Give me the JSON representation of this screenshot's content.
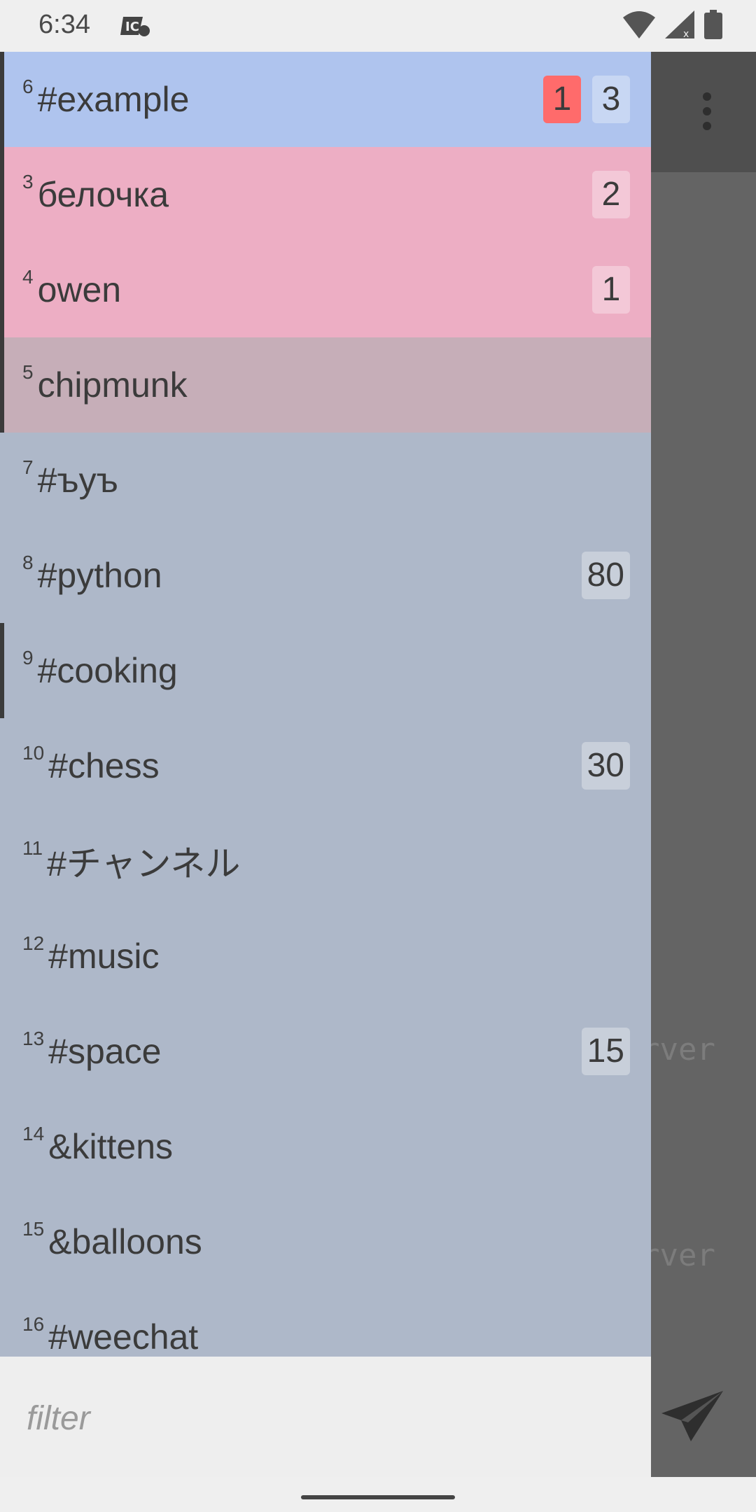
{
  "status_bar": {
    "time": "6:34",
    "icons": [
      "app-notification-icon",
      "wifi-icon",
      "cell-signal-icon",
      "battery-icon"
    ]
  },
  "background": {
    "text_1": "rver",
    "text_2": "rver"
  },
  "colors": {
    "active_row": "#afc4ee",
    "private_row": "#edaec4",
    "selected_private_row": "#c6aeb8",
    "drawer_bg": "#aeb8c9",
    "highlight_badge": "#ff6b6b"
  },
  "buffers": [
    {
      "num": "6",
      "name": "#example",
      "highlight": "1",
      "unread": "3"
    },
    {
      "num": "3",
      "name": "белочка",
      "unread": "2"
    },
    {
      "num": "4",
      "name": "owen",
      "unread": "1"
    },
    {
      "num": "5",
      "name": "chipmunk"
    },
    {
      "num": "7",
      "name": "#ъуъ"
    },
    {
      "num": "8",
      "name": "#python",
      "unread": "80"
    },
    {
      "num": "9",
      "name": "#cooking"
    },
    {
      "num": "10",
      "name": "#chess",
      "unread": "30"
    },
    {
      "num": "11",
      "name": "#チャンネル"
    },
    {
      "num": "12",
      "name": "#music"
    },
    {
      "num": "13",
      "name": "#space",
      "unread": "15"
    },
    {
      "num": "14",
      "name": "&kittens"
    },
    {
      "num": "15",
      "name": "&balloons"
    },
    {
      "num": "16",
      "name": "#weechat"
    }
  ],
  "filter": {
    "placeholder": "filter"
  }
}
